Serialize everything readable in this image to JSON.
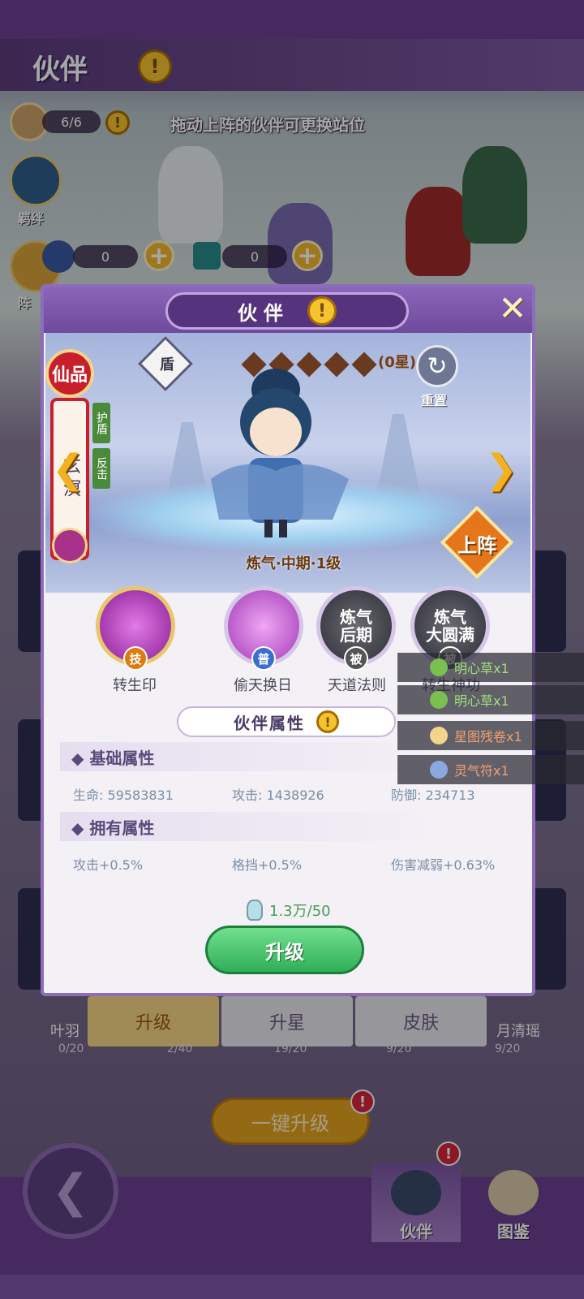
{
  "page": {
    "title": "伙伴",
    "team_count": "6/6",
    "hint": "拖动上阵的伙伴可更换站位",
    "bond_label": "羁绊",
    "formation_label": "阵",
    "res_a": "0",
    "res_b": "0"
  },
  "bg": {
    "card_names": [
      "叶羽",
      "",
      "",
      "",
      "月清瑶"
    ],
    "card_progress": [
      "0/20",
      "2/40",
      "19/20",
      "9/20",
      "9/20"
    ],
    "tabs": [
      "升级",
      "升星",
      "皮肤"
    ],
    "one_click": "一键升级",
    "nav_partner": "伙伴",
    "nav_codex": "图鉴"
  },
  "modal": {
    "title": "伙伴",
    "close": "✕",
    "rank": "仙品",
    "name": "玄溟",
    "tags": [
      "护盾",
      "反击"
    ],
    "role": "盾",
    "stars_text": "(0星)",
    "reset": "重置",
    "level": "炼气·中期·1级",
    "deploy": "上阵",
    "skills": [
      {
        "name": "转生印",
        "tag": "技",
        "color": "#b13ab8",
        "tag_color": "#e07a10"
      },
      {
        "name": "偷天换日",
        "tag": "普",
        "color": "#c55ad6",
        "tag_color": "#3a6fd1"
      },
      {
        "name": "天道法则",
        "tag": "被",
        "color": "#4a4a55",
        "tag_color": "#555",
        "locked": "炼气\n后期"
      },
      {
        "name": "转生神功",
        "tag": "被",
        "color": "#4a4a55",
        "tag_color": "#555",
        "locked": "炼气\n大圆满"
      }
    ],
    "attr_title": "伙伴属性",
    "basic_title": "◆ 基础属性",
    "basic": [
      {
        "label": "生命: 59583831"
      },
      {
        "label": "攻击: 1438926"
      },
      {
        "label": "防御: 234713"
      }
    ],
    "owned_title": "◆ 拥有属性",
    "owned": [
      {
        "label": "攻击+0.5%"
      },
      {
        "label": "格挡+0.5%"
      },
      {
        "label": "伤害减弱+0.63%"
      }
    ],
    "cost": "1.3万/50",
    "upgrade": "升级"
  },
  "drops": [
    {
      "text": "明心草x1",
      "color": "#9ee07a"
    },
    {
      "text": "明心草x1",
      "color": "#9ee07a"
    },
    {
      "text": "星图残卷x1",
      "color": "#f0a070"
    },
    {
      "text": "灵气符x1",
      "color": "#f0a070"
    }
  ],
  "colors": {
    "primary_purple": "#6b3f93",
    "gold": "#f2b21f",
    "upgrade_green": "#2fae58"
  }
}
